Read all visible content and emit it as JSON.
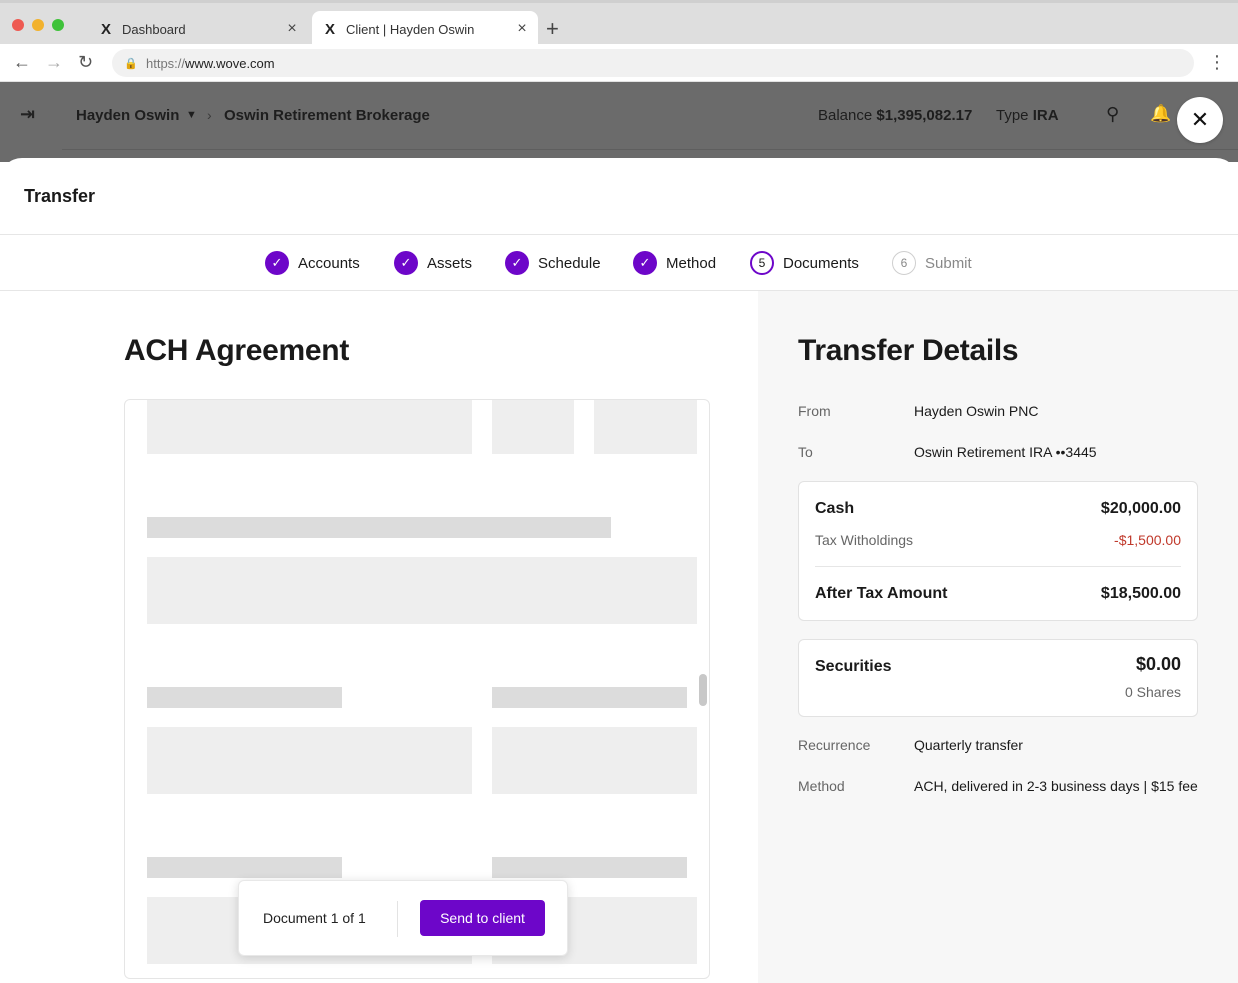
{
  "browser": {
    "tabs": [
      {
        "favicon": "X",
        "title": "Dashboard",
        "close": "×"
      },
      {
        "favicon": "X",
        "title": "Client | Hayden Oswin",
        "close": "×"
      }
    ],
    "new_tab": "+",
    "url_protocol": "https://",
    "url_host": "www.wove.com",
    "icons": {
      "back": "←",
      "forward": "→",
      "reload": "↻",
      "lock": "🔒",
      "menu": "⋮"
    }
  },
  "app_header": {
    "collapse_icon": "⇥",
    "client_name": "Hayden Oswin",
    "client_caret": "▼",
    "crumb_separator": "›",
    "account_name": "Oswin Retirement Brokerage",
    "balance_label": "Balance",
    "balance_value": "$1,395,082.17",
    "type_label": "Type",
    "type_value": "IRA",
    "search_icon": "⚲",
    "bell_icon": "🔔",
    "close_icon": "✕"
  },
  "modal": {
    "title": "Transfer",
    "steps": [
      {
        "label": "Accounts",
        "marker": "✓",
        "state": "done"
      },
      {
        "label": "Assets",
        "marker": "✓",
        "state": "done"
      },
      {
        "label": "Schedule",
        "marker": "✓",
        "state": "done"
      },
      {
        "label": "Method",
        "marker": "✓",
        "state": "done"
      },
      {
        "label": "Documents",
        "marker": "5",
        "state": "current"
      },
      {
        "label": "Submit",
        "marker": "6",
        "state": "pending"
      }
    ]
  },
  "document": {
    "heading": "ACH Agreement",
    "page_indicator": "Document 1 of 1",
    "send_label": "Send to client"
  },
  "details": {
    "heading": "Transfer Details",
    "from_label": "From",
    "from_value": "Hayden Oswin PNC",
    "to_label": "To",
    "to_value": "Oswin Retirement IRA ••3445",
    "cash": {
      "label": "Cash",
      "amount": "$20,000.00",
      "tax_label": "Tax Witholdings",
      "tax_amount": "-$1,500.00",
      "after_tax_label": "After Tax Amount",
      "after_tax_amount": "$18,500.00"
    },
    "securities": {
      "label": "Securities",
      "amount": "$0.00",
      "shares": "0 Shares"
    },
    "recurrence_label": "Recurrence",
    "recurrence_value": "Quarterly transfer",
    "method_label": "Method",
    "method_value": "ACH, delivered in 2-3 business days | $15 fee"
  },
  "colors": {
    "accent": "#6d06c9",
    "negative": "#c0392b",
    "overlay": "#6b6b6b"
  }
}
